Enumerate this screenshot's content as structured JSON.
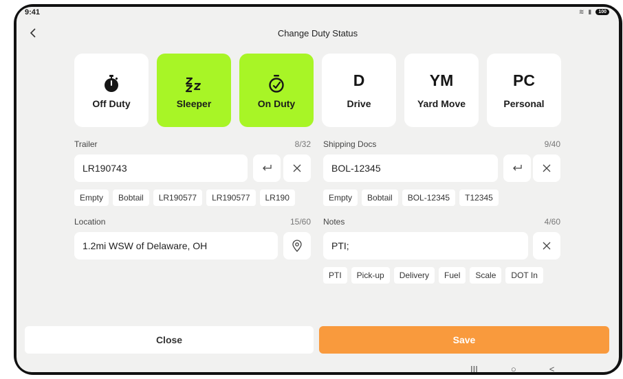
{
  "status_bar": {
    "time": "9:41",
    "battery": "100"
  },
  "header": {
    "title": "Change Duty Status"
  },
  "statuses": [
    {
      "label": "Off Duty",
      "icon": "stopwatch-icon",
      "active": false
    },
    {
      "label": "Sleeper",
      "icon": "zzz-icon",
      "active": true
    },
    {
      "label": "On Duty",
      "icon": "timer-check-icon",
      "active": true
    },
    {
      "letter": "D",
      "label": "Drive",
      "active": false
    },
    {
      "letter": "YM",
      "label": "Yard Move",
      "active": false
    },
    {
      "letter": "PC",
      "label": "Personal",
      "active": false
    }
  ],
  "trailer": {
    "label": "Trailer",
    "count": "8/32",
    "value": "LR190743",
    "chips": [
      "Empty",
      "Bobtail",
      "LR190577",
      "LR190577",
      "LR190"
    ]
  },
  "shipping": {
    "label": "Shipping Docs",
    "count": "9/40",
    "value": "BOL-12345",
    "chips": [
      "Empty",
      "Bobtail",
      "BOL-12345",
      "T12345"
    ]
  },
  "location": {
    "label": "Location",
    "count": "15/60",
    "value": "1.2mi WSW of Delaware, OH"
  },
  "notes": {
    "label": "Notes",
    "count": "4/60",
    "value": "PTI;",
    "chips": [
      "PTI",
      "Pick-up",
      "Delivery",
      "Fuel",
      "Scale",
      "DOT In"
    ]
  },
  "actions": {
    "close": "Close",
    "save": "Save"
  },
  "nav": {
    "recents": "III",
    "home": "○",
    "back": "<"
  },
  "colors": {
    "active": "#a8f526",
    "save": "#f99a3d",
    "background": "#f1f1f0"
  }
}
